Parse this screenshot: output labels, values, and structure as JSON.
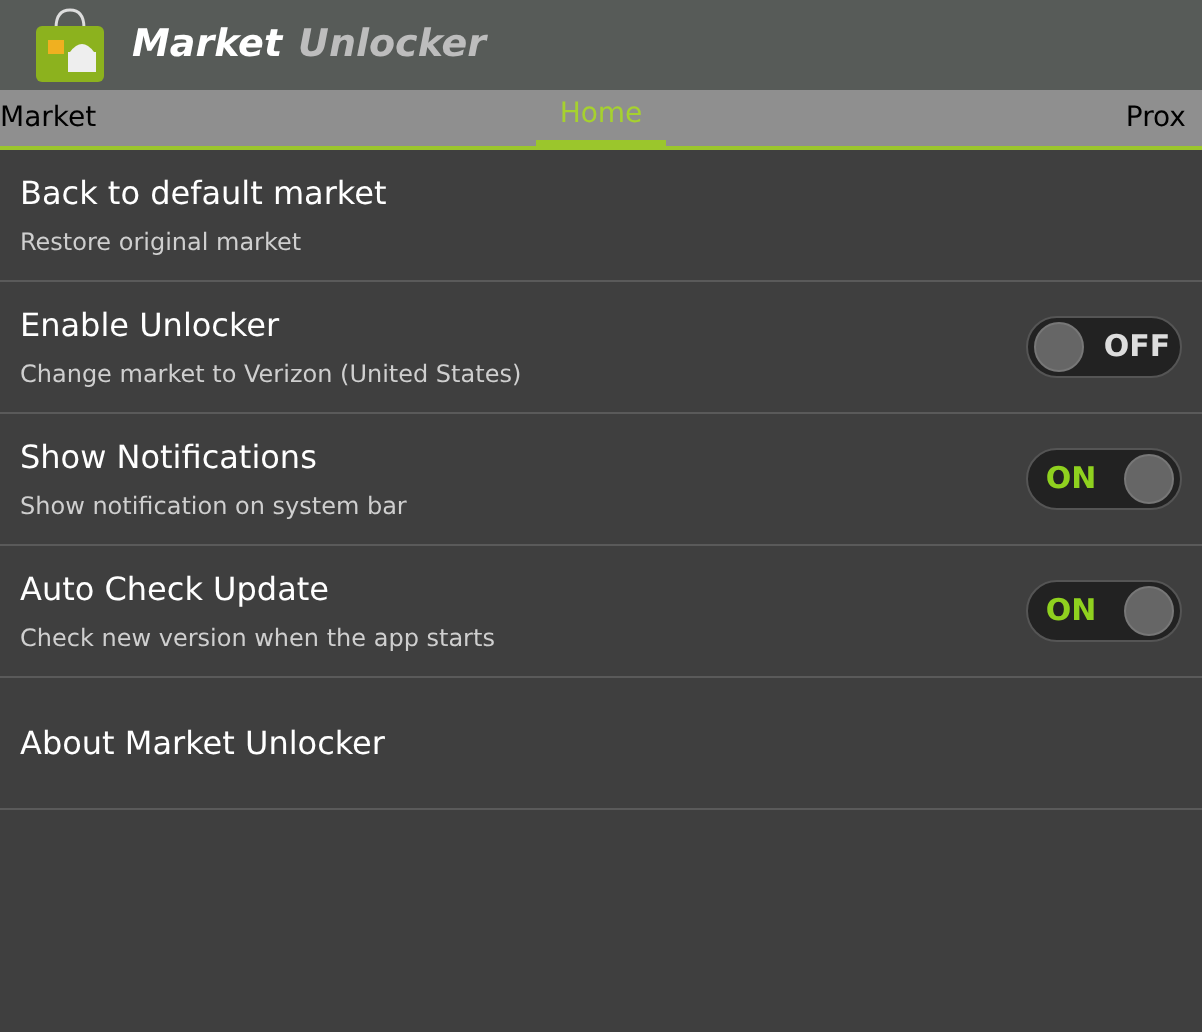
{
  "app_bar": {
    "title_first": "Market",
    "title_second": "Unlocker"
  },
  "tabs": [
    {
      "label": "Market",
      "selected": false
    },
    {
      "label": "Home",
      "selected": true
    },
    {
      "label": "Prox",
      "selected": false
    }
  ],
  "settings": [
    {
      "kind": "plain",
      "title": "Back to default market",
      "summary": "Restore original market"
    },
    {
      "kind": "switch",
      "title": "Enable Unlocker",
      "summary": "Change market to Verizon (United States)",
      "on": false,
      "switch_label": "OFF"
    },
    {
      "kind": "switch",
      "title": "Show Notifications",
      "summary": "Show notification on system bar",
      "on": true,
      "switch_label": "ON"
    },
    {
      "kind": "switch",
      "title": "Auto Check Update",
      "summary": "Check new version when the app starts",
      "on": true,
      "switch_label": "ON"
    },
    {
      "kind": "plain",
      "title": "About Market Unlocker"
    }
  ]
}
